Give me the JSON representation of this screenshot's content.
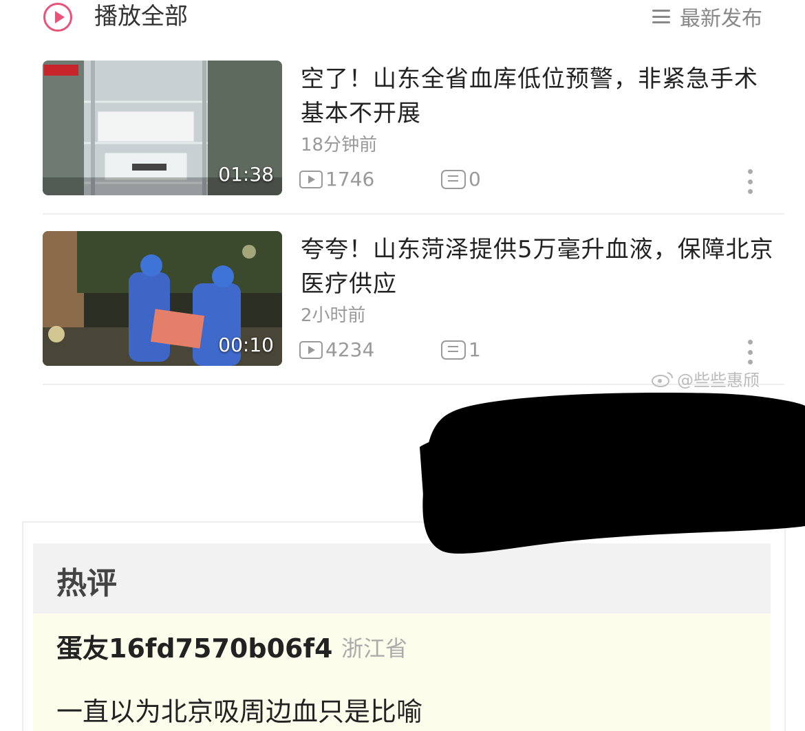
{
  "header": {
    "play_all_label": "播放全部",
    "sort_label": "最新发布",
    "icons": {
      "play_all": "play-circle-icon",
      "sort": "menu-icon"
    }
  },
  "videos": [
    {
      "title": "空了！山东全省血库低位预警，非紧急手术基本不开展",
      "time": "18分钟前",
      "duration": "01:38",
      "plays": "1746",
      "comments": "0"
    },
    {
      "title": "夸夸！山东菏泽提供5万毫升血液，保障北京医疗供应",
      "time": "2小时前",
      "duration": "00:10",
      "plays": "4234",
      "comments": "1"
    }
  ],
  "watermark": "@些些惠颀",
  "hot_comments": {
    "label": "热评",
    "items": [
      {
        "user": "蛋友16fd7570b06f4",
        "location": "浙江省",
        "text": "一直以为北京吸周边血只是比喻"
      }
    ]
  },
  "colors": {
    "accent": "#e8537a",
    "muted": "#999999",
    "comment_bg": "#fdfdec",
    "header_bg": "#f2f2f2"
  }
}
